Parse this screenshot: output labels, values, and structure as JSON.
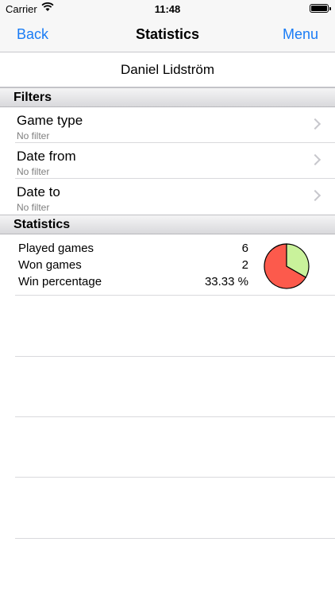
{
  "status_bar": {
    "carrier": "Carrier",
    "time": "11:48"
  },
  "nav": {
    "back_label": "Back",
    "title": "Statistics",
    "menu_label": "Menu",
    "tint_color": "#1a7cf5"
  },
  "player": {
    "name": "Daniel Lidström"
  },
  "filters": {
    "header": "Filters",
    "items": [
      {
        "label": "Game type",
        "value": "No filter"
      },
      {
        "label": "Date from",
        "value": "No filter"
      },
      {
        "label": "Date to",
        "value": "No filter"
      }
    ]
  },
  "statistics": {
    "header": "Statistics",
    "rows": [
      {
        "label": "Played games",
        "value": "6"
      },
      {
        "label": "Won games",
        "value": "2"
      },
      {
        "label": "Win percentage",
        "value": "33.33 %"
      }
    ],
    "pie": {
      "won_fraction": 0.3333,
      "won_color": "#c9f29b",
      "lost_color": "#fc5a4c"
    }
  }
}
